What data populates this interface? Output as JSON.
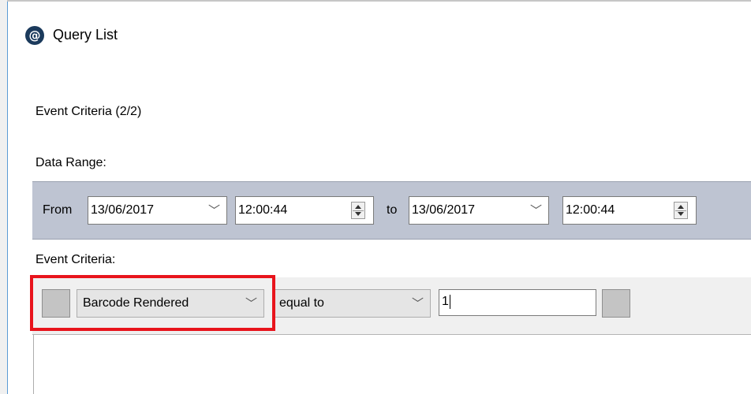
{
  "window": {
    "title": "Query List",
    "icon": "at-sign-icon"
  },
  "labels": {
    "step": "Event Criteria (2/2)",
    "data_range": "Data Range:",
    "event_criteria": "Event Criteria:"
  },
  "range": {
    "from_label": "From",
    "from_date": "13/06/2017",
    "from_time": "12:00:44",
    "to_label": "to",
    "to_date": "13/06/2017",
    "to_time": "12:00:44"
  },
  "criteria": {
    "field": "Barcode Rendered",
    "operator": "equal to",
    "value": "1"
  },
  "colors": {
    "highlight": "#e8141c",
    "range_panel": "#bec4d2"
  }
}
